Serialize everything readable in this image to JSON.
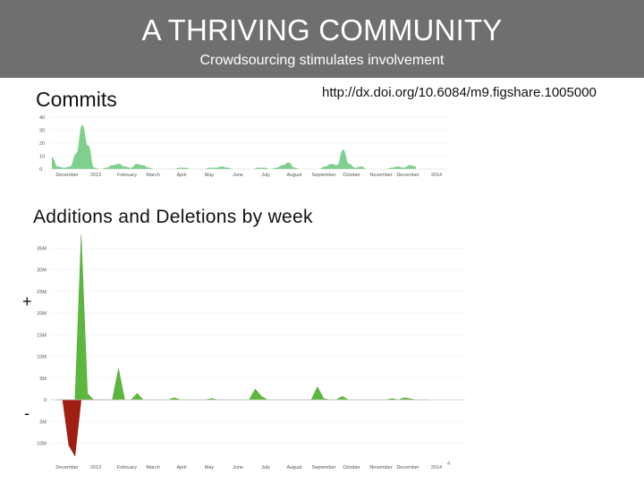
{
  "header": {
    "title": "A THRIVING COMMUNITY",
    "subtitle": "Crowdsourcing stimulates involvement"
  },
  "url": "http://dx.doi.org/10.6084/m9.figshare.1005000",
  "commits_heading": "Commits",
  "additions_heading": "Additions and Deletions by week",
  "plus_sign": "+",
  "minus_sign": "-",
  "page_number": "4",
  "colors": {
    "header_bg": "#6f6f6f",
    "commits_fill": "#7fcf8f",
    "additions_fill": "#5cb83c",
    "deletions_fill": "#a01e12"
  },
  "chart_data": [
    {
      "type": "area",
      "title": "Commits",
      "month_labels": [
        "December",
        "2013",
        "February",
        "March",
        "April",
        "May",
        "June",
        "July",
        "August",
        "September",
        "October",
        "November",
        "December",
        "2014"
      ],
      "yticks": [
        "0",
        "10",
        "20",
        "30",
        "40"
      ],
      "ylim": [
        0,
        40
      ],
      "x_weeks": [
        0,
        1,
        2,
        3,
        4,
        5,
        6,
        7,
        8,
        9,
        10,
        11,
        12,
        13,
        14,
        15,
        16,
        17,
        18,
        19,
        20,
        21,
        22,
        23,
        24,
        25,
        26,
        27,
        28,
        29,
        30,
        31,
        32,
        33,
        34,
        35,
        36,
        37,
        38,
        39,
        40,
        41,
        42,
        43,
        44,
        45,
        46,
        47,
        48,
        49,
        50,
        51,
        52,
        53,
        54,
        55,
        56,
        57,
        58,
        59,
        60
      ],
      "values": [
        9,
        2,
        1,
        2,
        12,
        34,
        18,
        1,
        0,
        1,
        3,
        4,
        2,
        1,
        4,
        3,
        1,
        0,
        0,
        0,
        0,
        1,
        1,
        0,
        0,
        0,
        1,
        1,
        2,
        1,
        0,
        0,
        0,
        0,
        1,
        1,
        0,
        1,
        3,
        5,
        1,
        0,
        0,
        0,
        0,
        2,
        4,
        3,
        15,
        4,
        1,
        2,
        0,
        0,
        0,
        0,
        1,
        2,
        1,
        3,
        2
      ]
    },
    {
      "type": "area",
      "title": "Additions and Deletions by week",
      "month_labels": [
        "December",
        "2013",
        "February",
        "March",
        "April",
        "May",
        "June",
        "July",
        "August",
        "September",
        "October",
        "November",
        "December",
        "2014"
      ],
      "yticks": [
        "10M",
        "5M",
        "0",
        "5M",
        "10M",
        "15M",
        "20M",
        "25M",
        "30M",
        "35M"
      ],
      "ylim": [
        -13,
        38
      ],
      "series": [
        {
          "name": "+",
          "x_weeks": [
            0,
            1,
            2,
            3,
            4,
            5,
            6,
            7,
            8,
            9,
            10,
            11,
            12,
            13,
            14,
            15,
            16,
            17,
            18,
            19,
            20,
            21,
            22,
            23,
            24,
            25,
            26,
            27,
            28,
            29,
            30,
            31,
            32,
            33,
            34,
            35,
            36,
            37,
            38,
            39,
            40,
            41,
            42,
            43,
            44,
            45,
            46,
            47,
            48,
            49,
            50,
            51,
            52,
            53,
            54,
            55,
            56,
            57,
            58,
            59,
            60
          ],
          "values": [
            0,
            0,
            0,
            0,
            38,
            1.5,
            0,
            0,
            0,
            0,
            7.2,
            0,
            0,
            1.5,
            0,
            0,
            0,
            0,
            0,
            0.5,
            0,
            0,
            0,
            0,
            0,
            0.3,
            0,
            0,
            0,
            0,
            0,
            0,
            2.5,
            0.8,
            0,
            0,
            0,
            0,
            0,
            0,
            0,
            0,
            3,
            0.3,
            0,
            0,
            0.8,
            0,
            0,
            0,
            0,
            0,
            0,
            0,
            0.3,
            0,
            0.5,
            0.2,
            0,
            0,
            0
          ],
          "unit": "M"
        },
        {
          "name": "-",
          "x_weeks": [
            0,
            1,
            2,
            3,
            4,
            5,
            6,
            7,
            8,
            9,
            10
          ],
          "values": [
            0,
            0,
            -10.5,
            -13,
            0,
            0,
            0,
            0,
            0,
            0,
            0
          ],
          "unit": "M"
        }
      ]
    }
  ]
}
